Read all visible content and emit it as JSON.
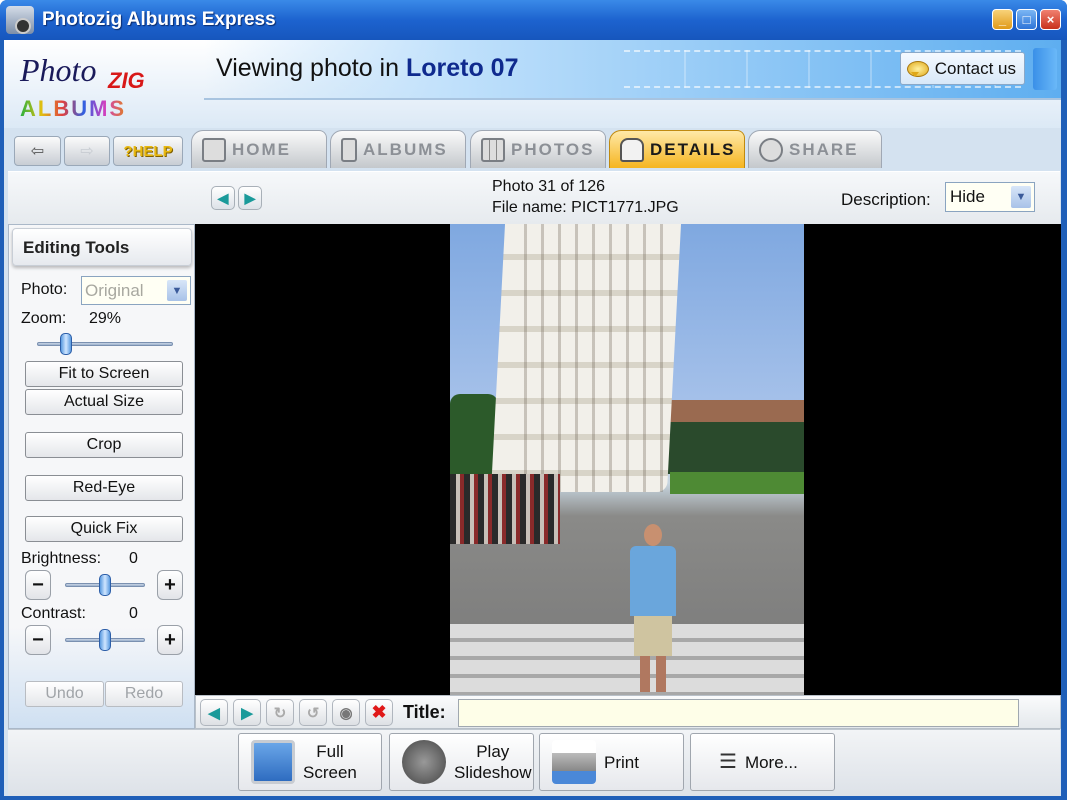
{
  "window": {
    "title": "Photozig Albums Express",
    "controls": {
      "minimize": "_",
      "maximize": "□",
      "close": "×"
    }
  },
  "logo": {
    "line1": "Photo",
    "line2": "ZIG",
    "line3": "ALBUMS"
  },
  "header": {
    "viewing_prefix": "Viewing photo in",
    "album_name": "Loreto 07",
    "contact_label": "Contact us"
  },
  "nav": {
    "back_glyph": "⇦",
    "forward_glyph": "⇨",
    "help_label": "HELP",
    "tabs": [
      {
        "label": "HOME",
        "active": false
      },
      {
        "label": "ALBUMS",
        "active": false
      },
      {
        "label": "PHOTOS",
        "active": false
      },
      {
        "label": "DETAILS",
        "active": true
      },
      {
        "label": "SHARE",
        "active": false
      }
    ]
  },
  "infobar": {
    "prev_glyph": "◀",
    "next_glyph": "▶",
    "photo_position": "Photo 31 of 126",
    "file_name": "File name: PICT1771.JPG",
    "description_label": "Description:",
    "description_value": "Hide"
  },
  "editing": {
    "heading": "Editing Tools",
    "photo_label": "Photo:",
    "photo_value": "Original",
    "zoom_label": "Zoom:",
    "zoom_value": "29%",
    "zoom_fraction": 0.18,
    "fit_to_screen": "Fit to Screen",
    "actual_size": "Actual Size",
    "crop": "Crop",
    "red_eye": "Red-Eye",
    "quick_fix": "Quick Fix",
    "brightness_label": "Brightness:",
    "brightness_value": "0",
    "contrast_label": "Contrast:",
    "contrast_value": "0",
    "minus": "−",
    "plus": "+",
    "undo": "Undo",
    "redo": "Redo"
  },
  "photo_toolbar": {
    "title_label": "Title:",
    "title_value": "",
    "prev_glyph": "◀",
    "next_glyph": "▶",
    "rotate_right_glyph": "↻",
    "rotate_left_glyph": "↺",
    "view_glyph": "◉",
    "delete_glyph": "✖"
  },
  "footer": {
    "full_screen": [
      "Full",
      "Screen"
    ],
    "slideshow": [
      "Play",
      "Slideshow"
    ],
    "print": "Print",
    "more": "More...",
    "more_glyph": "☰"
  },
  "colors": {
    "title_bar": "#1d63cf",
    "active_tab": "#f5b520",
    "album_name": "#0f2a8e"
  }
}
